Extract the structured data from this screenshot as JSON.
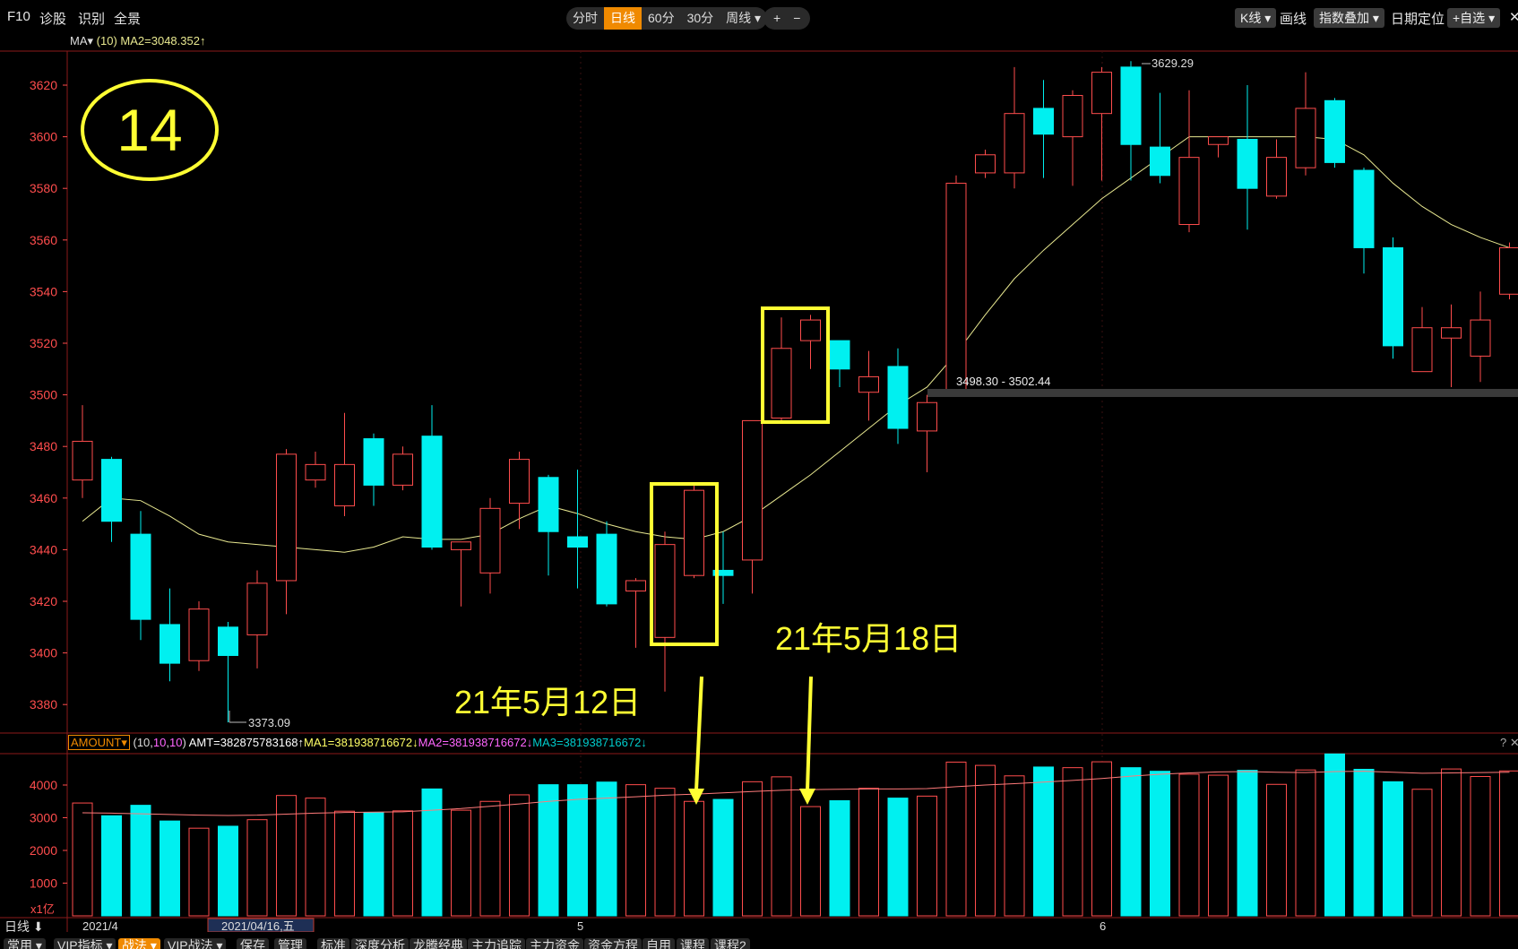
{
  "toolbar": {
    "left": [
      "F10",
      "诊股",
      "识别",
      "全景"
    ],
    "periods": [
      "分时",
      "日线",
      "60分",
      "30分",
      "周线 ▾"
    ],
    "active_period": "日线",
    "zoom": [
      "+",
      "−"
    ],
    "right": [
      "K线 ▾",
      "画线",
      "指数叠加 ▾",
      "日期定位",
      "+自选 ▾",
      "✕"
    ]
  },
  "main_info": {
    "ma_label": "MA▾",
    "ma_param": "(10)",
    "ma_value": "MA2=3048.352↑"
  },
  "annotations": {
    "circle_number": "14",
    "label_512": "21年5月12日",
    "label_518": "21年5月18日",
    "max_label": "3629.29",
    "min_label": "3373.09",
    "range_label": "3498.30 - 3502.44"
  },
  "volume_info": {
    "indicator": "AMOUNT▾",
    "param_open": "(",
    "param_a": "10",
    "param_b": "10",
    "param_c": "10",
    "param_close": ")",
    "amt": "AMT=382875783168↑",
    "ma1": "MA1=381938716672↓",
    "ma2": "MA2=381938716672↓",
    "ma3": "MA3=381938716672↓",
    "unit": "x1亿",
    "corner": "? ✕"
  },
  "xaxis": {
    "left_label": "日线 ⬇",
    "start": "2021/4",
    "cursor_date": "2021/04/16,五",
    "m5": "5",
    "m6": "6"
  },
  "bottom_tabs": [
    "常用 ▾",
    "VIP指标 ▾",
    "战法 ▾",
    "VIP战法 ▾",
    "保存",
    "管理",
    "标准",
    "深度分析",
    "龙腾经典",
    "主力追踪",
    "主力资金",
    "资金方程",
    "自用",
    "课程",
    "课程2"
  ],
  "colors": {
    "up": "#ff4d4d",
    "down": "#00f0f0",
    "ma": "#e8e890",
    "highlight": "#ffff33",
    "axis_text": "#ff4d4d",
    "vol_ma": "#ff7a7a"
  },
  "chart_data": [
    {
      "type": "candlestick",
      "title": "",
      "y_ticks": [
        3380,
        3400,
        3420,
        3440,
        3460,
        3480,
        3500,
        3520,
        3540,
        3560,
        3580,
        3600,
        3620
      ],
      "ylim": [
        3366,
        3632
      ],
      "candles": [
        {
          "o": 3467,
          "c": 3482,
          "h": 3496,
          "l": 3460
        },
        {
          "o": 3475,
          "c": 3451,
          "h": 3476,
          "l": 3443
        },
        {
          "o": 3446,
          "c": 3413,
          "h": 3455,
          "l": 3405
        },
        {
          "o": 3411,
          "c": 3396,
          "h": 3425,
          "l": 3389
        },
        {
          "o": 3397,
          "c": 3417,
          "h": 3420,
          "l": 3393
        },
        {
          "o": 3410,
          "c": 3399,
          "h": 3412,
          "l": 3373.09
        },
        {
          "o": 3407,
          "c": 3427,
          "h": 3432,
          "l": 3394
        },
        {
          "o": 3428,
          "c": 3477,
          "h": 3479,
          "l": 3415
        },
        {
          "o": 3467,
          "c": 3473,
          "h": 3478,
          "l": 3464
        },
        {
          "o": 3457,
          "c": 3473,
          "h": 3493,
          "l": 3453
        },
        {
          "o": 3483,
          "c": 3465,
          "h": 3485,
          "l": 3457
        },
        {
          "o": 3465,
          "c": 3477,
          "h": 3480,
          "l": 3463
        },
        {
          "o": 3484,
          "c": 3441,
          "h": 3496,
          "l": 3440
        },
        {
          "o": 3440,
          "c": 3443,
          "h": 3443,
          "l": 3418
        },
        {
          "o": 3431,
          "c": 3456,
          "h": 3460,
          "l": 3423
        },
        {
          "o": 3458,
          "c": 3475,
          "h": 3478,
          "l": 3448
        },
        {
          "o": 3468,
          "c": 3447,
          "h": 3469,
          "l": 3430
        },
        {
          "o": 3445,
          "c": 3441,
          "h": 3471,
          "l": 3425
        },
        {
          "o": 3446,
          "c": 3419,
          "h": 3451,
          "l": 3418
        },
        {
          "o": 3424,
          "c": 3428,
          "h": 3429,
          "l": 3402
        },
        {
          "o": 3406,
          "c": 3442,
          "h": 3447,
          "l": 3385
        },
        {
          "o": 3430,
          "c": 3463,
          "h": 3465,
          "l": 3429
        },
        {
          "o": 3432,
          "c": 3430,
          "h": 3447,
          "l": 3419
        },
        {
          "o": 3436,
          "c": 3490,
          "h": 3490,
          "l": 3423
        },
        {
          "o": 3491,
          "c": 3518,
          "h": 3530,
          "l": 3490
        },
        {
          "o": 3521,
          "c": 3529,
          "h": 3531,
          "l": 3510
        },
        {
          "o": 3521,
          "c": 3510,
          "h": 3521,
          "l": 3503
        },
        {
          "o": 3501,
          "c": 3507,
          "h": 3517,
          "l": 3490
        },
        {
          "o": 3511,
          "c": 3487,
          "h": 3518,
          "l": 3481
        },
        {
          "o": 3486,
          "c": 3497,
          "h": 3500,
          "l": 3470
        },
        {
          "o": 3502,
          "c": 3582,
          "h": 3585,
          "l": 3500
        },
        {
          "o": 3586,
          "c": 3593,
          "h": 3595,
          "l": 3584
        },
        {
          "o": 3586,
          "c": 3609,
          "h": 3627,
          "l": 3580
        },
        {
          "o": 3611,
          "c": 3601,
          "h": 3622,
          "l": 3584
        },
        {
          "o": 3600,
          "c": 3616,
          "h": 3618,
          "l": 3581
        },
        {
          "o": 3609,
          "c": 3625,
          "h": 3627,
          "l": 3583
        },
        {
          "o": 3627,
          "c": 3597,
          "h": 3629.29,
          "l": 3583
        },
        {
          "o": 3596,
          "c": 3585,
          "h": 3617,
          "l": 3582
        },
        {
          "o": 3566,
          "c": 3592,
          "h": 3618,
          "l": 3563
        },
        {
          "o": 3597,
          "c": 3600,
          "h": 3600,
          "l": 3592
        },
        {
          "o": 3599,
          "c": 3580,
          "h": 3620,
          "l": 3564
        },
        {
          "o": 3577,
          "c": 3592,
          "h": 3599,
          "l": 3576
        },
        {
          "o": 3588,
          "c": 3611,
          "h": 3625,
          "l": 3585
        },
        {
          "o": 3614,
          "c": 3590,
          "h": 3615,
          "l": 3588
        },
        {
          "o": 3587,
          "c": 3557,
          "h": 3588,
          "l": 3547
        },
        {
          "o": 3557,
          "c": 3519,
          "h": 3561,
          "l": 3514
        },
        {
          "o": 3509,
          "c": 3526,
          "h": 3534,
          "l": 3509
        },
        {
          "o": 3522,
          "c": 3526,
          "h": 3535,
          "l": 3503
        },
        {
          "o": 3515,
          "c": 3529,
          "h": 3540,
          "l": 3505
        },
        {
          "o": 3539,
          "c": 3557,
          "h": 3559,
          "l": 3537
        }
      ],
      "ma10": [
        3451,
        3460,
        3459,
        3453,
        3446,
        3443,
        3442,
        3441,
        3440,
        3439,
        3441,
        3445,
        3444,
        3444,
        3446,
        3452,
        3457,
        3454,
        3450,
        3447,
        3445,
        3444,
        3447,
        3453,
        3461,
        3469,
        3478,
        3487,
        3496,
        3503,
        3516,
        3531,
        3545,
        3556,
        3566,
        3576,
        3584,
        3592,
        3600,
        3600,
        3600,
        3600,
        3600,
        3599,
        3593,
        3582,
        3573,
        3566,
        3561,
        3557
      ]
    },
    {
      "type": "bar",
      "title": "",
      "unit": "x1亿",
      "y_ticks": [
        1000,
        2000,
        3000,
        4000
      ],
      "ylim": [
        0,
        4950
      ],
      "values": [
        3450,
        3060,
        3380,
        2900,
        2680,
        2740,
        2940,
        3680,
        3600,
        3200,
        3150,
        3210,
        3880,
        3230,
        3500,
        3700,
        4010,
        4010,
        4090,
        4010,
        3900,
        3500,
        3560,
        4100,
        4250,
        3340,
        3520,
        3900,
        3600,
        3660,
        4700,
        4600,
        4280,
        4550,
        4530,
        4710,
        4530,
        4420,
        4330,
        4300,
        4450,
        4020,
        4460,
        4950,
        4480,
        4100,
        3870,
        4490,
        4260,
        4430
      ],
      "ma": [
        3150,
        3140,
        3120,
        3100,
        3080,
        3070,
        3080,
        3110,
        3140,
        3160,
        3170,
        3180,
        3230,
        3280,
        3350,
        3420,
        3500,
        3560,
        3600,
        3640,
        3690,
        3720,
        3760,
        3800,
        3840,
        3860,
        3870,
        3880,
        3880,
        3890,
        3950,
        4000,
        4040,
        4090,
        4140,
        4200,
        4270,
        4330,
        4370,
        4400,
        4410,
        4390,
        4380,
        4410,
        4420,
        4390,
        4360,
        4370,
        4380,
        4390
      ]
    }
  ]
}
